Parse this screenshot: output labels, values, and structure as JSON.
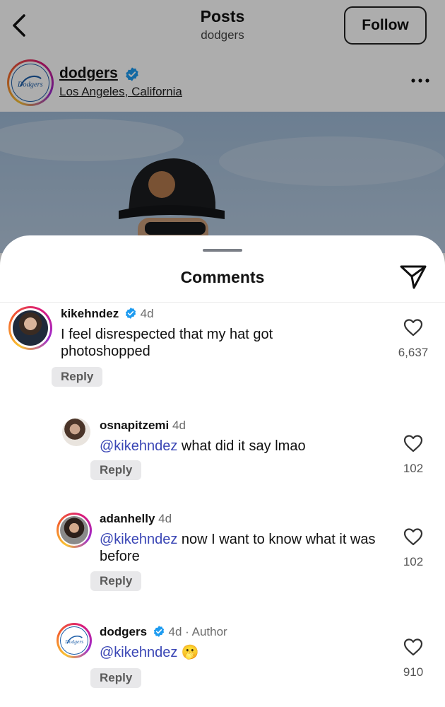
{
  "header": {
    "title": "Posts",
    "subtitle": "dodgers",
    "follow_label": "Follow"
  },
  "post": {
    "username": "dodgers",
    "location": "Los Angeles, California"
  },
  "comments_sheet": {
    "title": "Comments",
    "comments": [
      {
        "username": "kikehndez",
        "verified": true,
        "time": "4d",
        "text": "I feel disrespected that my hat got photoshopped",
        "likes": "6,637",
        "reply_label": "Reply"
      },
      {
        "username": "osnapitzemi",
        "verified": false,
        "time": "4d",
        "mention": "@kikehndez",
        "text": " what did it say lmao",
        "likes": "102",
        "reply_label": "Reply"
      },
      {
        "username": "adanhelly",
        "verified": false,
        "time": "4d",
        "mention": "@kikehndez",
        "text": " now I want to know what it was before",
        "likes": "102",
        "reply_label": "Reply"
      },
      {
        "username": "dodgers",
        "verified": true,
        "time": "4d · Author",
        "mention": "@kikehndez",
        "text": " 🫢",
        "likes": "910",
        "reply_label": "Reply"
      }
    ]
  },
  "icons": [
    "back-icon",
    "verified-icon",
    "more-icon",
    "share-icon",
    "heart-icon"
  ],
  "colors": {
    "mention": "#3a46b5",
    "verified": "#1d9bf0",
    "reply_bg": "#e8e8ea"
  }
}
